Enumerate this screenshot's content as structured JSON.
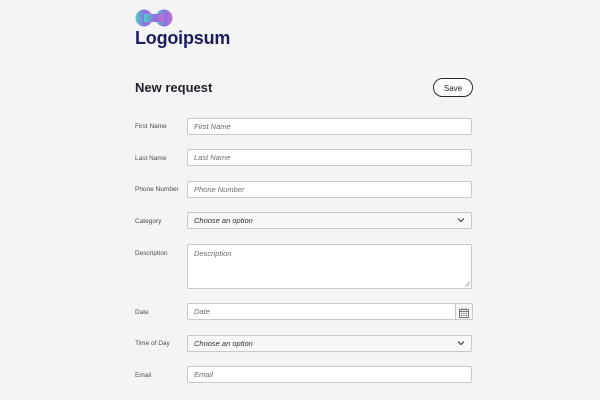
{
  "brand": {
    "name": "Logoipsum",
    "colors": {
      "teal": "#4fd1c5",
      "pink": "#c86fd0",
      "violet": "#8a70e0",
      "navy": "#1d1d5c"
    }
  },
  "form": {
    "title": "New request",
    "save_label": "Save",
    "fields": {
      "first_name": {
        "label": "First Name",
        "placeholder": "First Name",
        "value": ""
      },
      "last_name": {
        "label": "Last Name",
        "placeholder": "Last Name",
        "value": ""
      },
      "phone": {
        "label": "Phone Number",
        "placeholder": "Phone Number",
        "value": ""
      },
      "category": {
        "label": "Category",
        "selected": "Choose an option"
      },
      "description": {
        "label": "Description",
        "placeholder": "Description",
        "value": ""
      },
      "date": {
        "label": "Date",
        "placeholder": "Date",
        "value": ""
      },
      "time_of_day": {
        "label": "Time of Day",
        "selected": "Choose an option"
      },
      "email": {
        "label": "Email",
        "placeholder": "Email",
        "value": ""
      }
    }
  },
  "icons": {
    "logo": "logo-mark-icon",
    "chevron": "chevron-down-icon",
    "calendar": "calendar-icon",
    "resize": "resize-handle-icon"
  }
}
